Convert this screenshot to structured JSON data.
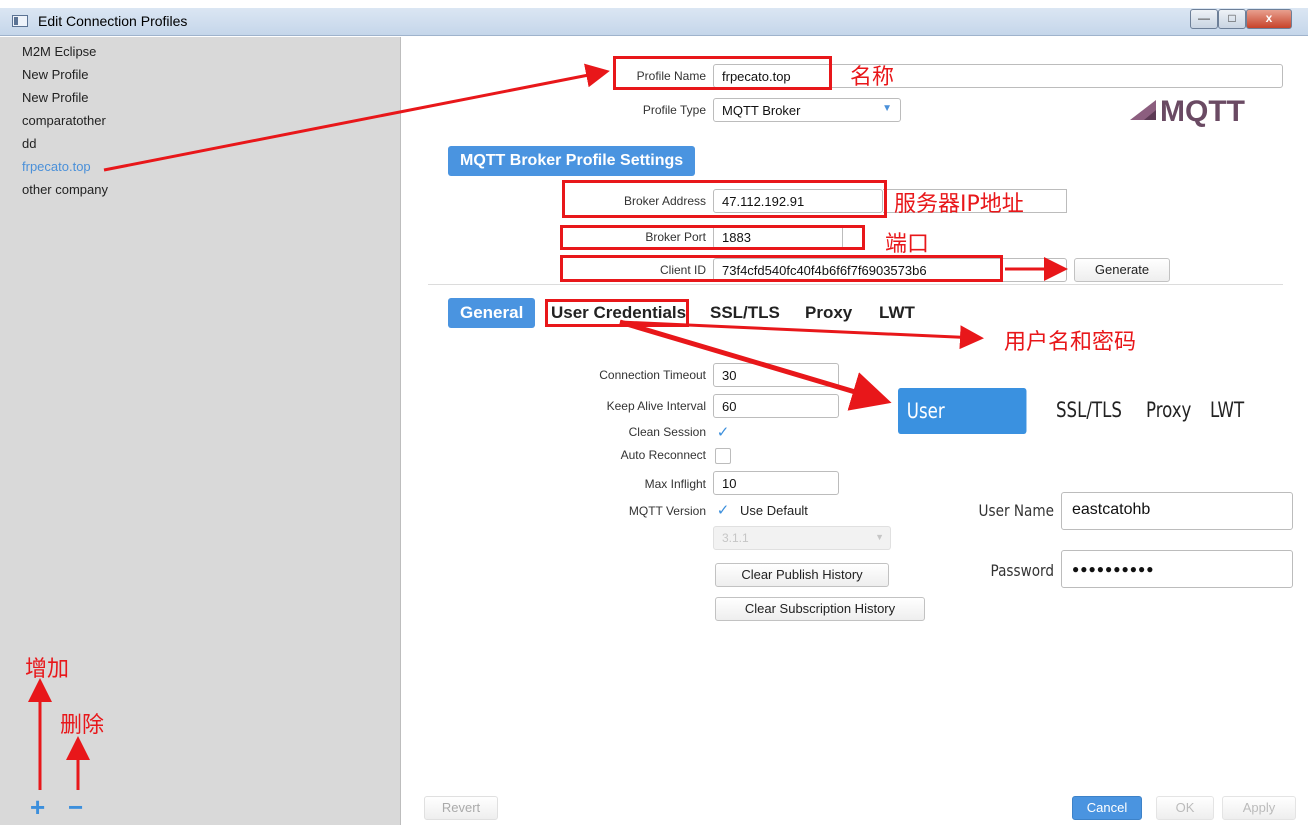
{
  "window": {
    "title": "Edit Connection Profiles",
    "controls": {
      "minimize": "—",
      "maximize": "□",
      "close": "x"
    }
  },
  "sidebar": {
    "profiles": [
      "M2M Eclipse",
      "New Profile",
      "New Profile",
      "comparatother",
      "dd",
      "frpecato.top",
      "other company"
    ],
    "selected_index": 5,
    "add_label": "+",
    "remove_label": "−"
  },
  "profile": {
    "name_label": "Profile Name",
    "name_value": "frpecato.top",
    "type_label": "Profile Type",
    "type_value": "MQTT Broker",
    "logo_text": "MQTT"
  },
  "broker": {
    "section_title": "MQTT Broker Profile Settings",
    "address_label": "Broker Address",
    "address_value": "47.112.192.91",
    "port_label": "Broker Port",
    "port_value": "1883",
    "client_id_label": "Client ID",
    "client_id_value": "73f4cfd540fc40f4b6f6f7f6903573b6",
    "generate_label": "Generate"
  },
  "tabs": [
    "General",
    "User Credentials",
    "SSL/TLS",
    "Proxy",
    "LWT"
  ],
  "general": {
    "timeout_label": "Connection Timeout",
    "timeout_value": "30",
    "keepalive_label": "Keep Alive Interval",
    "keepalive_value": "60",
    "clean_session_label": "Clean Session",
    "clean_session_checked": true,
    "auto_reconnect_label": "Auto Reconnect",
    "auto_reconnect_checked": false,
    "max_inflight_label": "Max Inflight",
    "max_inflight_value": "10",
    "mqtt_version_label": "MQTT Version",
    "use_default_label": "Use Default",
    "use_default_checked": true,
    "version_value": "3.1.1",
    "clear_publish_label": "Clear Publish History",
    "clear_subscription_label": "Clear Subscription History"
  },
  "credentials": {
    "user_name_label": "User Name",
    "user_name_value": "eastcatohb",
    "password_label": "Password",
    "password_value": "●●●●●●●●●●"
  },
  "footer": {
    "revert_label": "Revert",
    "cancel_label": "Cancel",
    "ok_label": "OK",
    "apply_label": "Apply"
  },
  "annotations": {
    "name": "名称",
    "server_ip": "服务器IP地址",
    "port": "端口",
    "user_and_password": "用户名和密码",
    "add": "增加",
    "delete": "删除"
  },
  "colors": {
    "accent": "#4a94e0",
    "annotation_red": "#e8171a",
    "sidebar_bg": "#d9d9d9",
    "selected_profile": "#4a90d9"
  }
}
